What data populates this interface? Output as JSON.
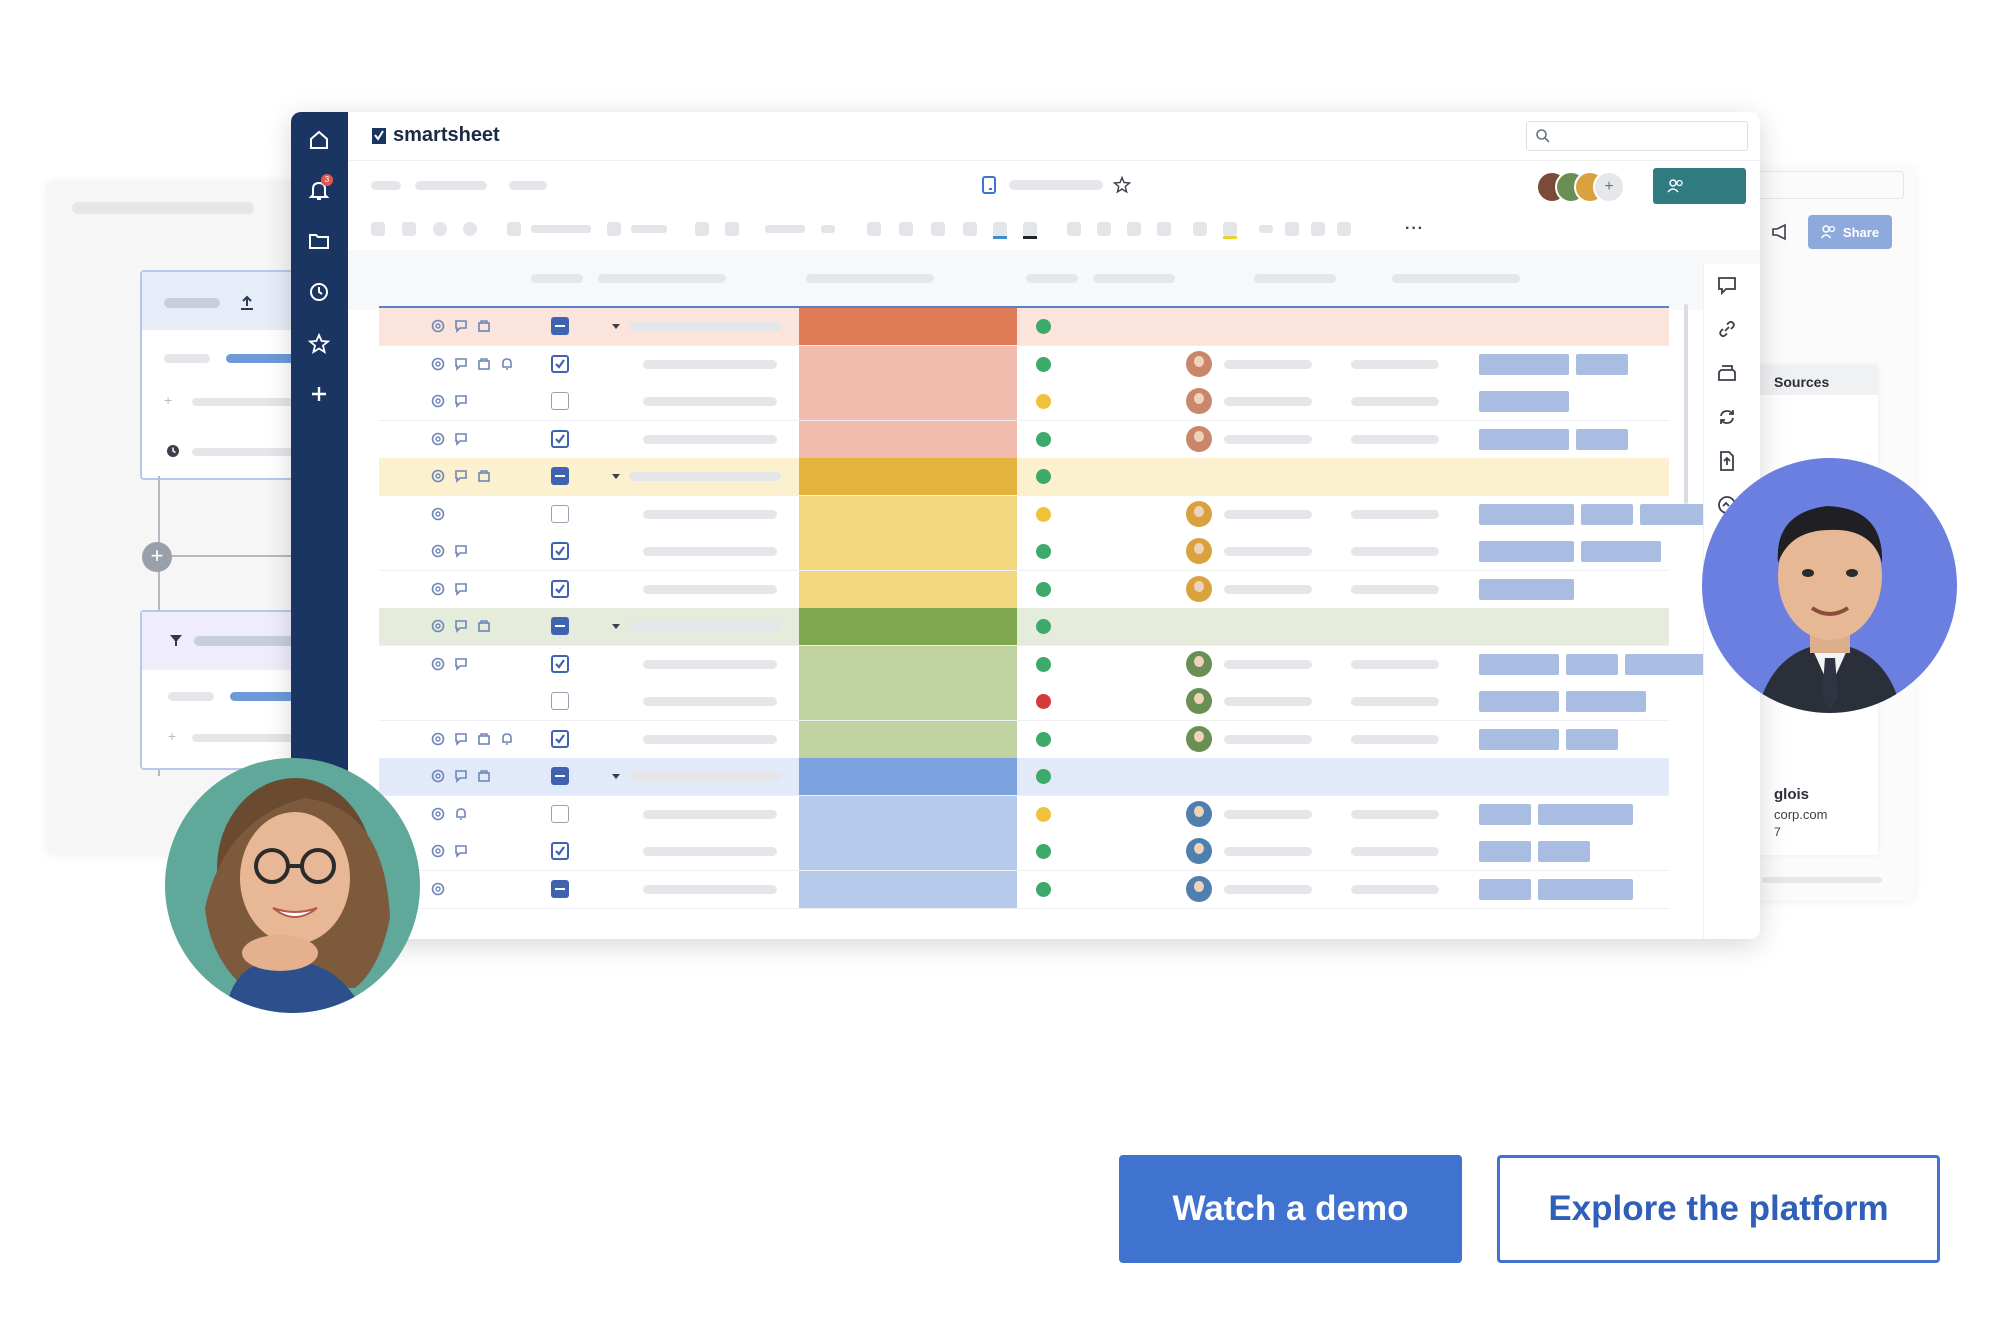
{
  "app": {
    "brand": "smartsheet"
  },
  "sidebar": {
    "items": [
      {
        "icon": "home-icon"
      },
      {
        "icon": "bell-icon",
        "badge": "3"
      },
      {
        "icon": "folder-icon"
      },
      {
        "icon": "clock-icon"
      },
      {
        "icon": "star-icon"
      },
      {
        "icon": "plus-icon"
      }
    ]
  },
  "right_panel": {
    "share_label": "Share",
    "sources_label": "Sources",
    "contact_name_fragment": "glois",
    "contact_email_fragment": "corp.com",
    "contact_extra_fragment": "7"
  },
  "grid": {
    "rows": [
      {
        "type": "group",
        "tint": "#fbe4dc",
        "cell": "#e07b57",
        "dot": "#3daa6b",
        "check": "minus"
      },
      {
        "type": "row",
        "tint": "#ffffff",
        "cell": "#f1bcad",
        "dot": "#3daa6b",
        "check": "checked",
        "avatar": "#c9866b",
        "tags": [
          90,
          52
        ]
      },
      {
        "type": "row",
        "tint": "#ffffff",
        "cell": "#f1bcad",
        "dot": "#f0c23c",
        "check": "empty",
        "avatar": "#c9866b",
        "tags": [
          90
        ]
      },
      {
        "type": "row",
        "tint": "#ffffff",
        "cell": "#f1bcad",
        "dot": "#3daa6b",
        "check": "checked",
        "avatar": "#c9866b",
        "tags": [
          90,
          52
        ]
      },
      {
        "type": "group",
        "tint": "#fbf1cf",
        "cell": "#e3b33d",
        "dot": "#3daa6b",
        "check": "minus"
      },
      {
        "type": "row",
        "tint": "#ffffff",
        "cell": "#f3d77e",
        "dot": "#f0c23c",
        "check": "empty",
        "avatar": "#d9a23f",
        "tags": [
          95,
          52,
          80
        ]
      },
      {
        "type": "row",
        "tint": "#ffffff",
        "cell": "#f3d77e",
        "dot": "#3daa6b",
        "check": "checked",
        "avatar": "#d9a23f",
        "tags": [
          95,
          80
        ]
      },
      {
        "type": "row",
        "tint": "#ffffff",
        "cell": "#f3d77e",
        "dot": "#3daa6b",
        "check": "checked",
        "avatar": "#d9a23f",
        "tags": [
          95
        ]
      },
      {
        "type": "group",
        "tint": "#e6ecdc",
        "cell": "#7fa84e",
        "dot": "#3daa6b",
        "check": "minus"
      },
      {
        "type": "row",
        "tint": "#ffffff",
        "cell": "#bfd2a0",
        "dot": "#3daa6b",
        "check": "checked",
        "avatar": "#6a8f55",
        "tags": [
          80,
          52,
          80
        ]
      },
      {
        "type": "row",
        "tint": "#ffffff",
        "cell": "#bfd2a0",
        "dot": "#d33b3b",
        "check": "empty",
        "avatar": "#6a8f55",
        "tags": [
          80,
          80
        ]
      },
      {
        "type": "row",
        "tint": "#ffffff",
        "cell": "#bfd2a0",
        "dot": "#3daa6b",
        "check": "checked",
        "avatar": "#6a8f55",
        "tags": [
          80,
          52
        ]
      },
      {
        "type": "group",
        "tint": "#e2e9f8",
        "cell": "#7ba2de",
        "dot": "#3daa6b",
        "check": "minus"
      },
      {
        "type": "row",
        "tint": "#ffffff",
        "cell": "#b5c9ea",
        "dot": "#f0c23c",
        "check": "empty",
        "avatar": "#4f7fae",
        "tags": [
          52,
          95
        ]
      },
      {
        "type": "row",
        "tint": "#ffffff",
        "cell": "#b5c9ea",
        "dot": "#3daa6b",
        "check": "checked",
        "avatar": "#4f7fae",
        "tags": [
          52,
          52
        ]
      },
      {
        "type": "row",
        "tint": "#ffffff",
        "cell": "#b5c9ea",
        "dot": "#3daa6b",
        "check": "minus",
        "avatar": "#4f7fae",
        "tags": [
          52,
          95
        ]
      }
    ]
  },
  "cta": {
    "demo_label": "Watch a demo",
    "explore_label": "Explore the platform"
  },
  "colors": {
    "sidebar": "#1b3563",
    "primary": "#3f73cf",
    "header_button": "#2f7b80",
    "share_button": "#8ea9dc",
    "avatar_left_bg": "#5fa89a",
    "avatar_right_bg": "#6b7fe0"
  }
}
